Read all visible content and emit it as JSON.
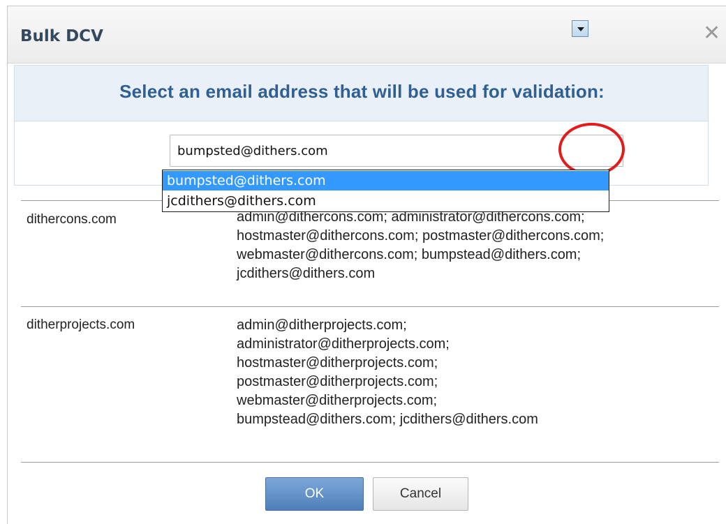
{
  "dialog": {
    "title": "Bulk DCV",
    "close_glyph": "✕"
  },
  "prompt": "Select an email address that will be used for validation:",
  "select": {
    "value": "bumpsted@dithers.com",
    "options": [
      "bumpsted@dithers.com",
      "jcdithers@dithers.com"
    ]
  },
  "rows": [
    {
      "domain": "dithercons.com",
      "emails": "admin@dithercons.com; administrator@dithercons.com;\nhostmaster@dithercons.com; postmaster@dithercons.com;\nwebmaster@dithercons.com; bumpstead@dithers.com;\njcdithers@dithers.com"
    },
    {
      "domain": "ditherprojects.com",
      "emails": "admin@ditherprojects.com;\nadministrator@ditherprojects.com;\nhostmaster@ditherprojects.com;\npostmaster@ditherprojects.com;\nwebmaster@ditherprojects.com;\nbumpstead@dithers.com; jcdithers@dithers.com"
    }
  ],
  "buttons": {
    "ok": "OK",
    "cancel": "Cancel"
  },
  "colors": {
    "accent": "#2f5f93",
    "selection": "#3399ff",
    "highlight_ring": "#e31b1b"
  },
  "icons": {
    "close": "close-icon",
    "dropdown": "chevron-down-icon"
  }
}
